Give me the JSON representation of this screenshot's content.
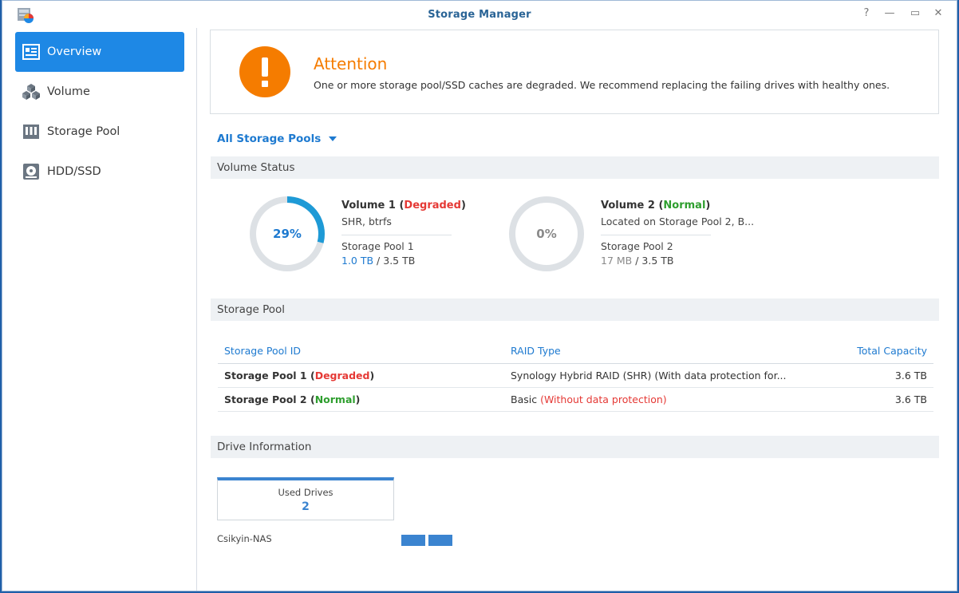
{
  "window": {
    "title": "Storage Manager"
  },
  "titlebar_controls": [
    "?",
    "—",
    "▭",
    "✕"
  ],
  "sidebar": {
    "items": [
      {
        "label": "Overview",
        "icon": "overview-icon",
        "active": true
      },
      {
        "label": "Volume",
        "icon": "cubes-icon",
        "active": false
      },
      {
        "label": "Storage Pool",
        "icon": "storage-pool-icon",
        "active": false
      },
      {
        "label": "HDD/SSD",
        "icon": "hdd-icon",
        "active": false
      }
    ]
  },
  "alert": {
    "icon": "exclamation-icon",
    "title": "Attention",
    "message": "One or more storage pool/SSD caches are degraded. We recommend replacing the failing drives with healthy ones."
  },
  "pool_filter": "All Storage Pools",
  "volume_status": {
    "heading": "Volume Status",
    "volumes": [
      {
        "percent": "29%",
        "percent_value": 29,
        "name": "Volume 1",
        "status": "Degraded",
        "sub": "SHR, btrfs",
        "pool": "Storage Pool 1",
        "used": "1.0 TB",
        "total": "3.5 TB"
      },
      {
        "percent": "0%",
        "percent_value": 0,
        "name": "Volume 2",
        "status": "Normal",
        "sub": "Located on Storage Pool 2, B...",
        "pool": "Storage Pool 2",
        "used": "17 MB",
        "total": "3.5 TB"
      }
    ]
  },
  "storage_pool": {
    "heading": "Storage Pool",
    "columns": [
      "Storage Pool ID",
      "RAID Type",
      "Total Capacity"
    ],
    "rows": [
      {
        "id": "Storage Pool 1",
        "status": "Degraded",
        "raid": "Synology Hybrid RAID (SHR) (With data protection for...",
        "raid_note": "",
        "capacity": "3.6 TB"
      },
      {
        "id": "Storage Pool 2",
        "status": "Normal",
        "raid": "Basic",
        "raid_note": "(Without data protection)",
        "capacity": "3.6 TB"
      }
    ]
  },
  "drive_info": {
    "heading": "Drive Information",
    "used_label": "Used Drives",
    "used_count": "2",
    "nas_name": "Csikyin-NAS"
  },
  "colors": {
    "accent": "#1e88e5",
    "warning": "#f57c00",
    "degraded": "#e53935",
    "normal": "#2e9e2e"
  }
}
